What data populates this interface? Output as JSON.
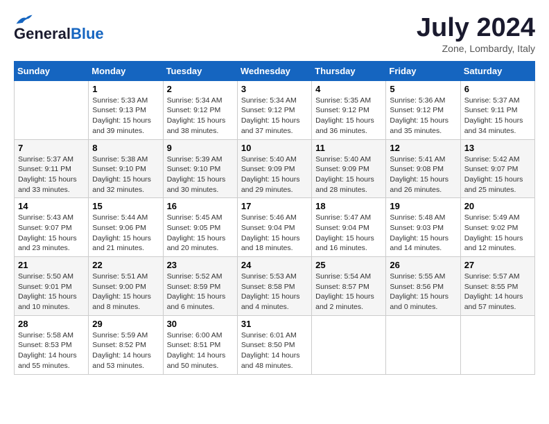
{
  "logo": {
    "general": "General",
    "blue": "Blue"
  },
  "title": "July 2024",
  "subtitle": "Zone, Lombardy, Italy",
  "days_of_week": [
    "Sunday",
    "Monday",
    "Tuesday",
    "Wednesday",
    "Thursday",
    "Friday",
    "Saturday"
  ],
  "weeks": [
    [
      {
        "day": "",
        "info": ""
      },
      {
        "day": "1",
        "info": "Sunrise: 5:33 AM\nSunset: 9:13 PM\nDaylight: 15 hours\nand 39 minutes."
      },
      {
        "day": "2",
        "info": "Sunrise: 5:34 AM\nSunset: 9:12 PM\nDaylight: 15 hours\nand 38 minutes."
      },
      {
        "day": "3",
        "info": "Sunrise: 5:34 AM\nSunset: 9:12 PM\nDaylight: 15 hours\nand 37 minutes."
      },
      {
        "day": "4",
        "info": "Sunrise: 5:35 AM\nSunset: 9:12 PM\nDaylight: 15 hours\nand 36 minutes."
      },
      {
        "day": "5",
        "info": "Sunrise: 5:36 AM\nSunset: 9:12 PM\nDaylight: 15 hours\nand 35 minutes."
      },
      {
        "day": "6",
        "info": "Sunrise: 5:37 AM\nSunset: 9:11 PM\nDaylight: 15 hours\nand 34 minutes."
      }
    ],
    [
      {
        "day": "7",
        "info": "Sunrise: 5:37 AM\nSunset: 9:11 PM\nDaylight: 15 hours\nand 33 minutes."
      },
      {
        "day": "8",
        "info": "Sunrise: 5:38 AM\nSunset: 9:10 PM\nDaylight: 15 hours\nand 32 minutes."
      },
      {
        "day": "9",
        "info": "Sunrise: 5:39 AM\nSunset: 9:10 PM\nDaylight: 15 hours\nand 30 minutes."
      },
      {
        "day": "10",
        "info": "Sunrise: 5:40 AM\nSunset: 9:09 PM\nDaylight: 15 hours\nand 29 minutes."
      },
      {
        "day": "11",
        "info": "Sunrise: 5:40 AM\nSunset: 9:09 PM\nDaylight: 15 hours\nand 28 minutes."
      },
      {
        "day": "12",
        "info": "Sunrise: 5:41 AM\nSunset: 9:08 PM\nDaylight: 15 hours\nand 26 minutes."
      },
      {
        "day": "13",
        "info": "Sunrise: 5:42 AM\nSunset: 9:07 PM\nDaylight: 15 hours\nand 25 minutes."
      }
    ],
    [
      {
        "day": "14",
        "info": "Sunrise: 5:43 AM\nSunset: 9:07 PM\nDaylight: 15 hours\nand 23 minutes."
      },
      {
        "day": "15",
        "info": "Sunrise: 5:44 AM\nSunset: 9:06 PM\nDaylight: 15 hours\nand 21 minutes."
      },
      {
        "day": "16",
        "info": "Sunrise: 5:45 AM\nSunset: 9:05 PM\nDaylight: 15 hours\nand 20 minutes."
      },
      {
        "day": "17",
        "info": "Sunrise: 5:46 AM\nSunset: 9:04 PM\nDaylight: 15 hours\nand 18 minutes."
      },
      {
        "day": "18",
        "info": "Sunrise: 5:47 AM\nSunset: 9:04 PM\nDaylight: 15 hours\nand 16 minutes."
      },
      {
        "day": "19",
        "info": "Sunrise: 5:48 AM\nSunset: 9:03 PM\nDaylight: 15 hours\nand 14 minutes."
      },
      {
        "day": "20",
        "info": "Sunrise: 5:49 AM\nSunset: 9:02 PM\nDaylight: 15 hours\nand 12 minutes."
      }
    ],
    [
      {
        "day": "21",
        "info": "Sunrise: 5:50 AM\nSunset: 9:01 PM\nDaylight: 15 hours\nand 10 minutes."
      },
      {
        "day": "22",
        "info": "Sunrise: 5:51 AM\nSunset: 9:00 PM\nDaylight: 15 hours\nand 8 minutes."
      },
      {
        "day": "23",
        "info": "Sunrise: 5:52 AM\nSunset: 8:59 PM\nDaylight: 15 hours\nand 6 minutes."
      },
      {
        "day": "24",
        "info": "Sunrise: 5:53 AM\nSunset: 8:58 PM\nDaylight: 15 hours\nand 4 minutes."
      },
      {
        "day": "25",
        "info": "Sunrise: 5:54 AM\nSunset: 8:57 PM\nDaylight: 15 hours\nand 2 minutes."
      },
      {
        "day": "26",
        "info": "Sunrise: 5:55 AM\nSunset: 8:56 PM\nDaylight: 15 hours\nand 0 minutes."
      },
      {
        "day": "27",
        "info": "Sunrise: 5:57 AM\nSunset: 8:55 PM\nDaylight: 14 hours\nand 57 minutes."
      }
    ],
    [
      {
        "day": "28",
        "info": "Sunrise: 5:58 AM\nSunset: 8:53 PM\nDaylight: 14 hours\nand 55 minutes."
      },
      {
        "day": "29",
        "info": "Sunrise: 5:59 AM\nSunset: 8:52 PM\nDaylight: 14 hours\nand 53 minutes."
      },
      {
        "day": "30",
        "info": "Sunrise: 6:00 AM\nSunset: 8:51 PM\nDaylight: 14 hours\nand 50 minutes."
      },
      {
        "day": "31",
        "info": "Sunrise: 6:01 AM\nSunset: 8:50 PM\nDaylight: 14 hours\nand 48 minutes."
      },
      {
        "day": "",
        "info": ""
      },
      {
        "day": "",
        "info": ""
      },
      {
        "day": "",
        "info": ""
      }
    ]
  ]
}
